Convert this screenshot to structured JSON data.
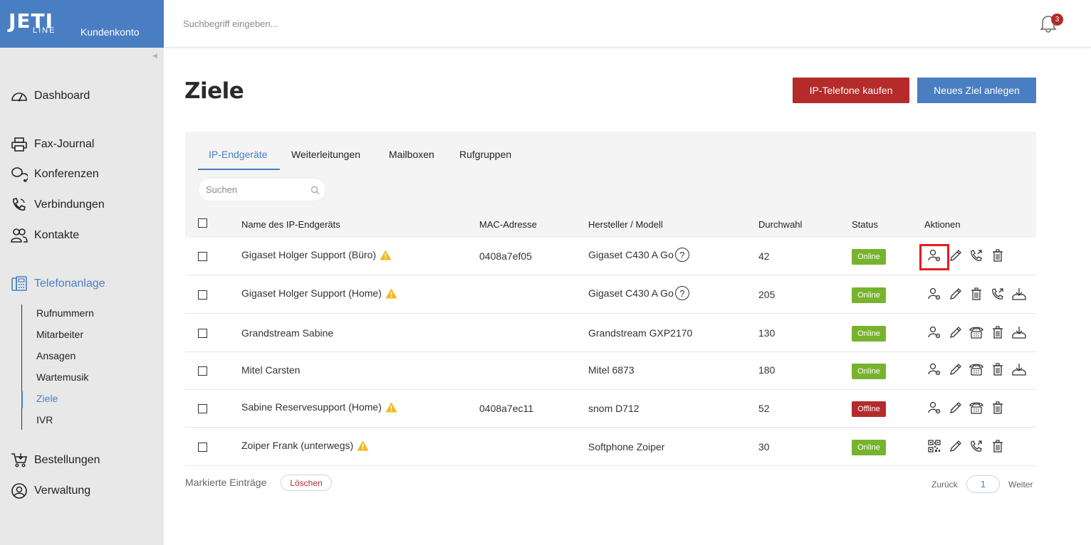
{
  "brand": {
    "logo_top": "JETI",
    "logo_bottom": "LINE",
    "account": "Kundenkonto"
  },
  "topbar": {
    "search_placeholder": "Suchbegriff eingeben...",
    "notification_count": "3"
  },
  "sidebar": {
    "items": [
      {
        "label": "Dashboard",
        "icon": "gauge-icon"
      },
      {
        "label": "Fax-Journal",
        "icon": "printer-icon"
      },
      {
        "label": "Konferenzen",
        "icon": "chat-bubbles-icon"
      },
      {
        "label": "Verbindungen",
        "icon": "phone-icon"
      },
      {
        "label": "Kontakte",
        "icon": "contacts-icon"
      },
      {
        "label": "Telefonanlage",
        "icon": "pbx-icon"
      },
      {
        "label": "Bestellungen",
        "icon": "cart-icon"
      },
      {
        "label": "Verwaltung",
        "icon": "user-circle-icon"
      }
    ],
    "subitems": [
      "Rufnummern",
      "Mitarbeiter",
      "Ansagen",
      "Wartemusik",
      "Ziele",
      "IVR"
    ]
  },
  "page": {
    "title": "Ziele",
    "buy_button": "IP-Telefone kaufen",
    "new_button": "Neues Ziel anlegen"
  },
  "tabs": [
    "IP-Endgeräte",
    "Weiterleitungen",
    "Mailboxen",
    "Rufgruppen"
  ],
  "search": {
    "placeholder": "Suchen"
  },
  "table": {
    "columns": [
      "Name des IP-Endgeräts",
      "MAC-Adresse",
      "Hersteller / Modell",
      "Durchwahl",
      "Status",
      "Aktionen"
    ],
    "rows": [
      {
        "name": "Gigaset Holger Support (Büro)",
        "mac": "0408a7ef05",
        "model": "Gigaset C430 A Go",
        "ext": "42",
        "status": "Online"
      },
      {
        "name": "Gigaset Holger Support (Home)",
        "mac": "",
        "model": "Gigaset C430 A Go",
        "ext": "205",
        "status": "Online"
      },
      {
        "name": "Grandstream Sabine",
        "mac": "",
        "model": "Grandstream GXP2170",
        "ext": "130",
        "status": "Online"
      },
      {
        "name": "Mitel Carsten",
        "mac": "",
        "model": "Mitel 6873",
        "ext": "180",
        "status": "Online"
      },
      {
        "name": "Sabine Reservesupport (Home)",
        "mac": "0408a7ec11",
        "model": "snom D712",
        "ext": "52",
        "status": "Offline"
      },
      {
        "name": "Zoiper Frank (unterwegs)",
        "mac": "",
        "model": "Softphone Zoiper",
        "ext": "30",
        "status": "Online"
      }
    ],
    "help_glyph": "?"
  },
  "footer": {
    "marked_label": "Markierte Einträge",
    "delete_button": "Löschen",
    "pager_back": "Zurück",
    "pager_page": "1",
    "pager_next": "Weiter"
  },
  "colors": {
    "brand_blue": "#4a7ec2",
    "danger_red": "#b52b2b",
    "online_green": "#77b32c",
    "highlight": "#e41d1d"
  }
}
